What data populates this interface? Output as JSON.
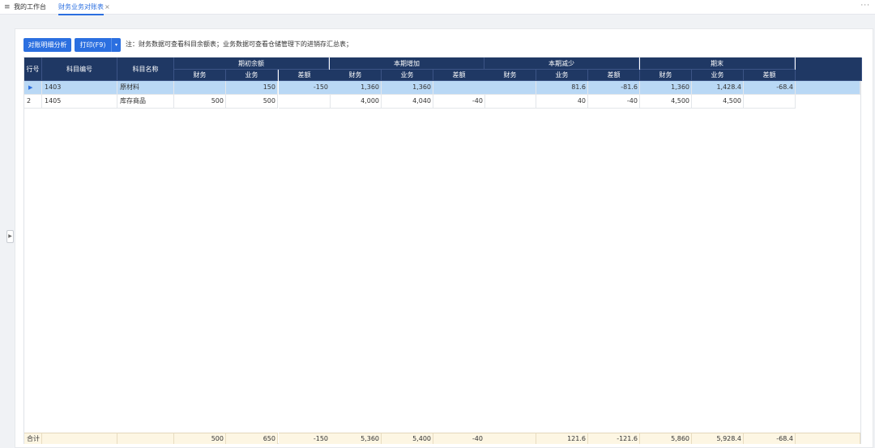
{
  "topbar": {
    "home_tab": "我的工作台",
    "active_tab": "财务业务对账表",
    "close_glyph": "×",
    "more_glyph": "···"
  },
  "toolbar": {
    "analyze_label": "对账明细分析",
    "print_label": "打印(F9)",
    "print_dropdown_glyph": "▾",
    "note": "注：财务数据可查看科目余额表；业务数据可查看仓储管理下的进销存汇总表；"
  },
  "table": {
    "headers": {
      "row_no": "行号",
      "code": "科目编号",
      "name": "科目名称",
      "groups": [
        "期初余额",
        "本期增加",
        "本期减少",
        "期末"
      ],
      "sub": [
        "财务",
        "业务",
        "差额"
      ]
    },
    "rows": [
      {
        "row_no": "",
        "selected": true,
        "code": "1403",
        "name": "原材料",
        "values": [
          "",
          "150",
          "-150",
          "1,360",
          "1,360",
          "",
          "",
          "81.6",
          "-81.6",
          "1,360",
          "1,428.4",
          "-68.4"
        ]
      },
      {
        "row_no": "2",
        "selected": false,
        "code": "1405",
        "name": "库存商品",
        "values": [
          "500",
          "500",
          "",
          "4,000",
          "4,040",
          "-40",
          "",
          "40",
          "-40",
          "4,500",
          "4,500",
          ""
        ]
      }
    ],
    "footer": {
      "label": "合计",
      "values": [
        "500",
        "650",
        "-150",
        "5,360",
        "5,400",
        "-40",
        "",
        "121.6",
        "-121.6",
        "5,860",
        "5,928.4",
        "-68.4"
      ]
    }
  },
  "colors": {
    "primary": "#2b6fe0",
    "header_bg": "#1f3864",
    "selected_row": "#b9d8f5",
    "footer_bg": "#fdf6e3"
  },
  "icons": {
    "selected_row_marker": "play-arrow-icon",
    "collapse_handle": "chevron-right-icon",
    "menu": "filter-menu-icon"
  }
}
